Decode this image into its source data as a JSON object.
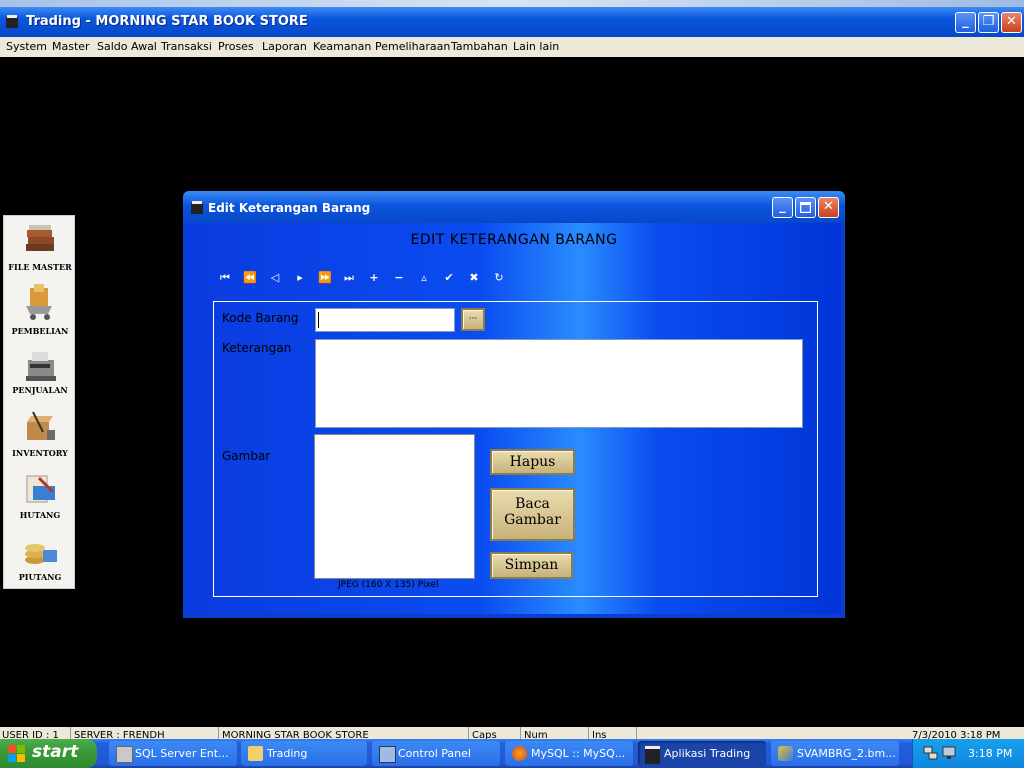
{
  "window": {
    "title": "Trading - MORNING STAR BOOK STORE",
    "controls": {
      "minimize": "_",
      "restore": "❐",
      "close": "✕"
    }
  },
  "menu": [
    "System",
    "Master",
    "Saldo Awal",
    "Transaksi",
    "Proses",
    "Laporan",
    "Keamanan",
    "Pemeliharaan",
    "Tambahan",
    "Lain lain"
  ],
  "sidebar": {
    "items": [
      {
        "label": "FILE MASTER",
        "icon": "books-icon"
      },
      {
        "label": "PEMBELIAN",
        "icon": "shopping-cart-icon"
      },
      {
        "label": "PENJUALAN",
        "icon": "cash-register-icon"
      },
      {
        "label": "INVENTORY",
        "icon": "inventory-icon"
      },
      {
        "label": "HUTANG",
        "icon": "debt-icon"
      },
      {
        "label": "PIUTANG",
        "icon": "coins-icon"
      }
    ]
  },
  "dialog": {
    "title": "Edit Keterangan Barang",
    "heading": "EDIT KETERANGAN BARANG",
    "nav": [
      "⏮",
      "⏪",
      "◁",
      "▸",
      "⏩",
      "⏭",
      "+",
      "−",
      "▵",
      "✔",
      "✖",
      "↻"
    ],
    "form": {
      "kode_label": "Kode Barang",
      "kode_value": "",
      "lookup_label": "···",
      "keterangan_label": "Keterangan",
      "keterangan_value": "",
      "gambar_label": "Gambar",
      "jpeg_note": "JPEG (160 X 135) Pixel",
      "hapus": "Hapus",
      "baca_gambar": "Baca Gambar",
      "simpan": "Simpan"
    }
  },
  "statusbar": [
    "USER ID : 1",
    "SERVER : FRENDH",
    "MORNING STAR BOOK STORE",
    "Caps",
    "Num",
    "Ins",
    "7/3/2010 3:18 PM"
  ],
  "taskbar": {
    "start": "start",
    "buttons": [
      "SQL Server Ent...",
      "Trading",
      "Control Panel",
      "MySQL :: MySQ...",
      "Aplikasi Trading",
      "SVAMBRG_2.bm..."
    ],
    "time": "3:18 PM"
  },
  "colors": {
    "dialog_bg": "#0a3fd0",
    "button_gold": "#d4c08a",
    "xp_blue": "#0a55dd"
  }
}
